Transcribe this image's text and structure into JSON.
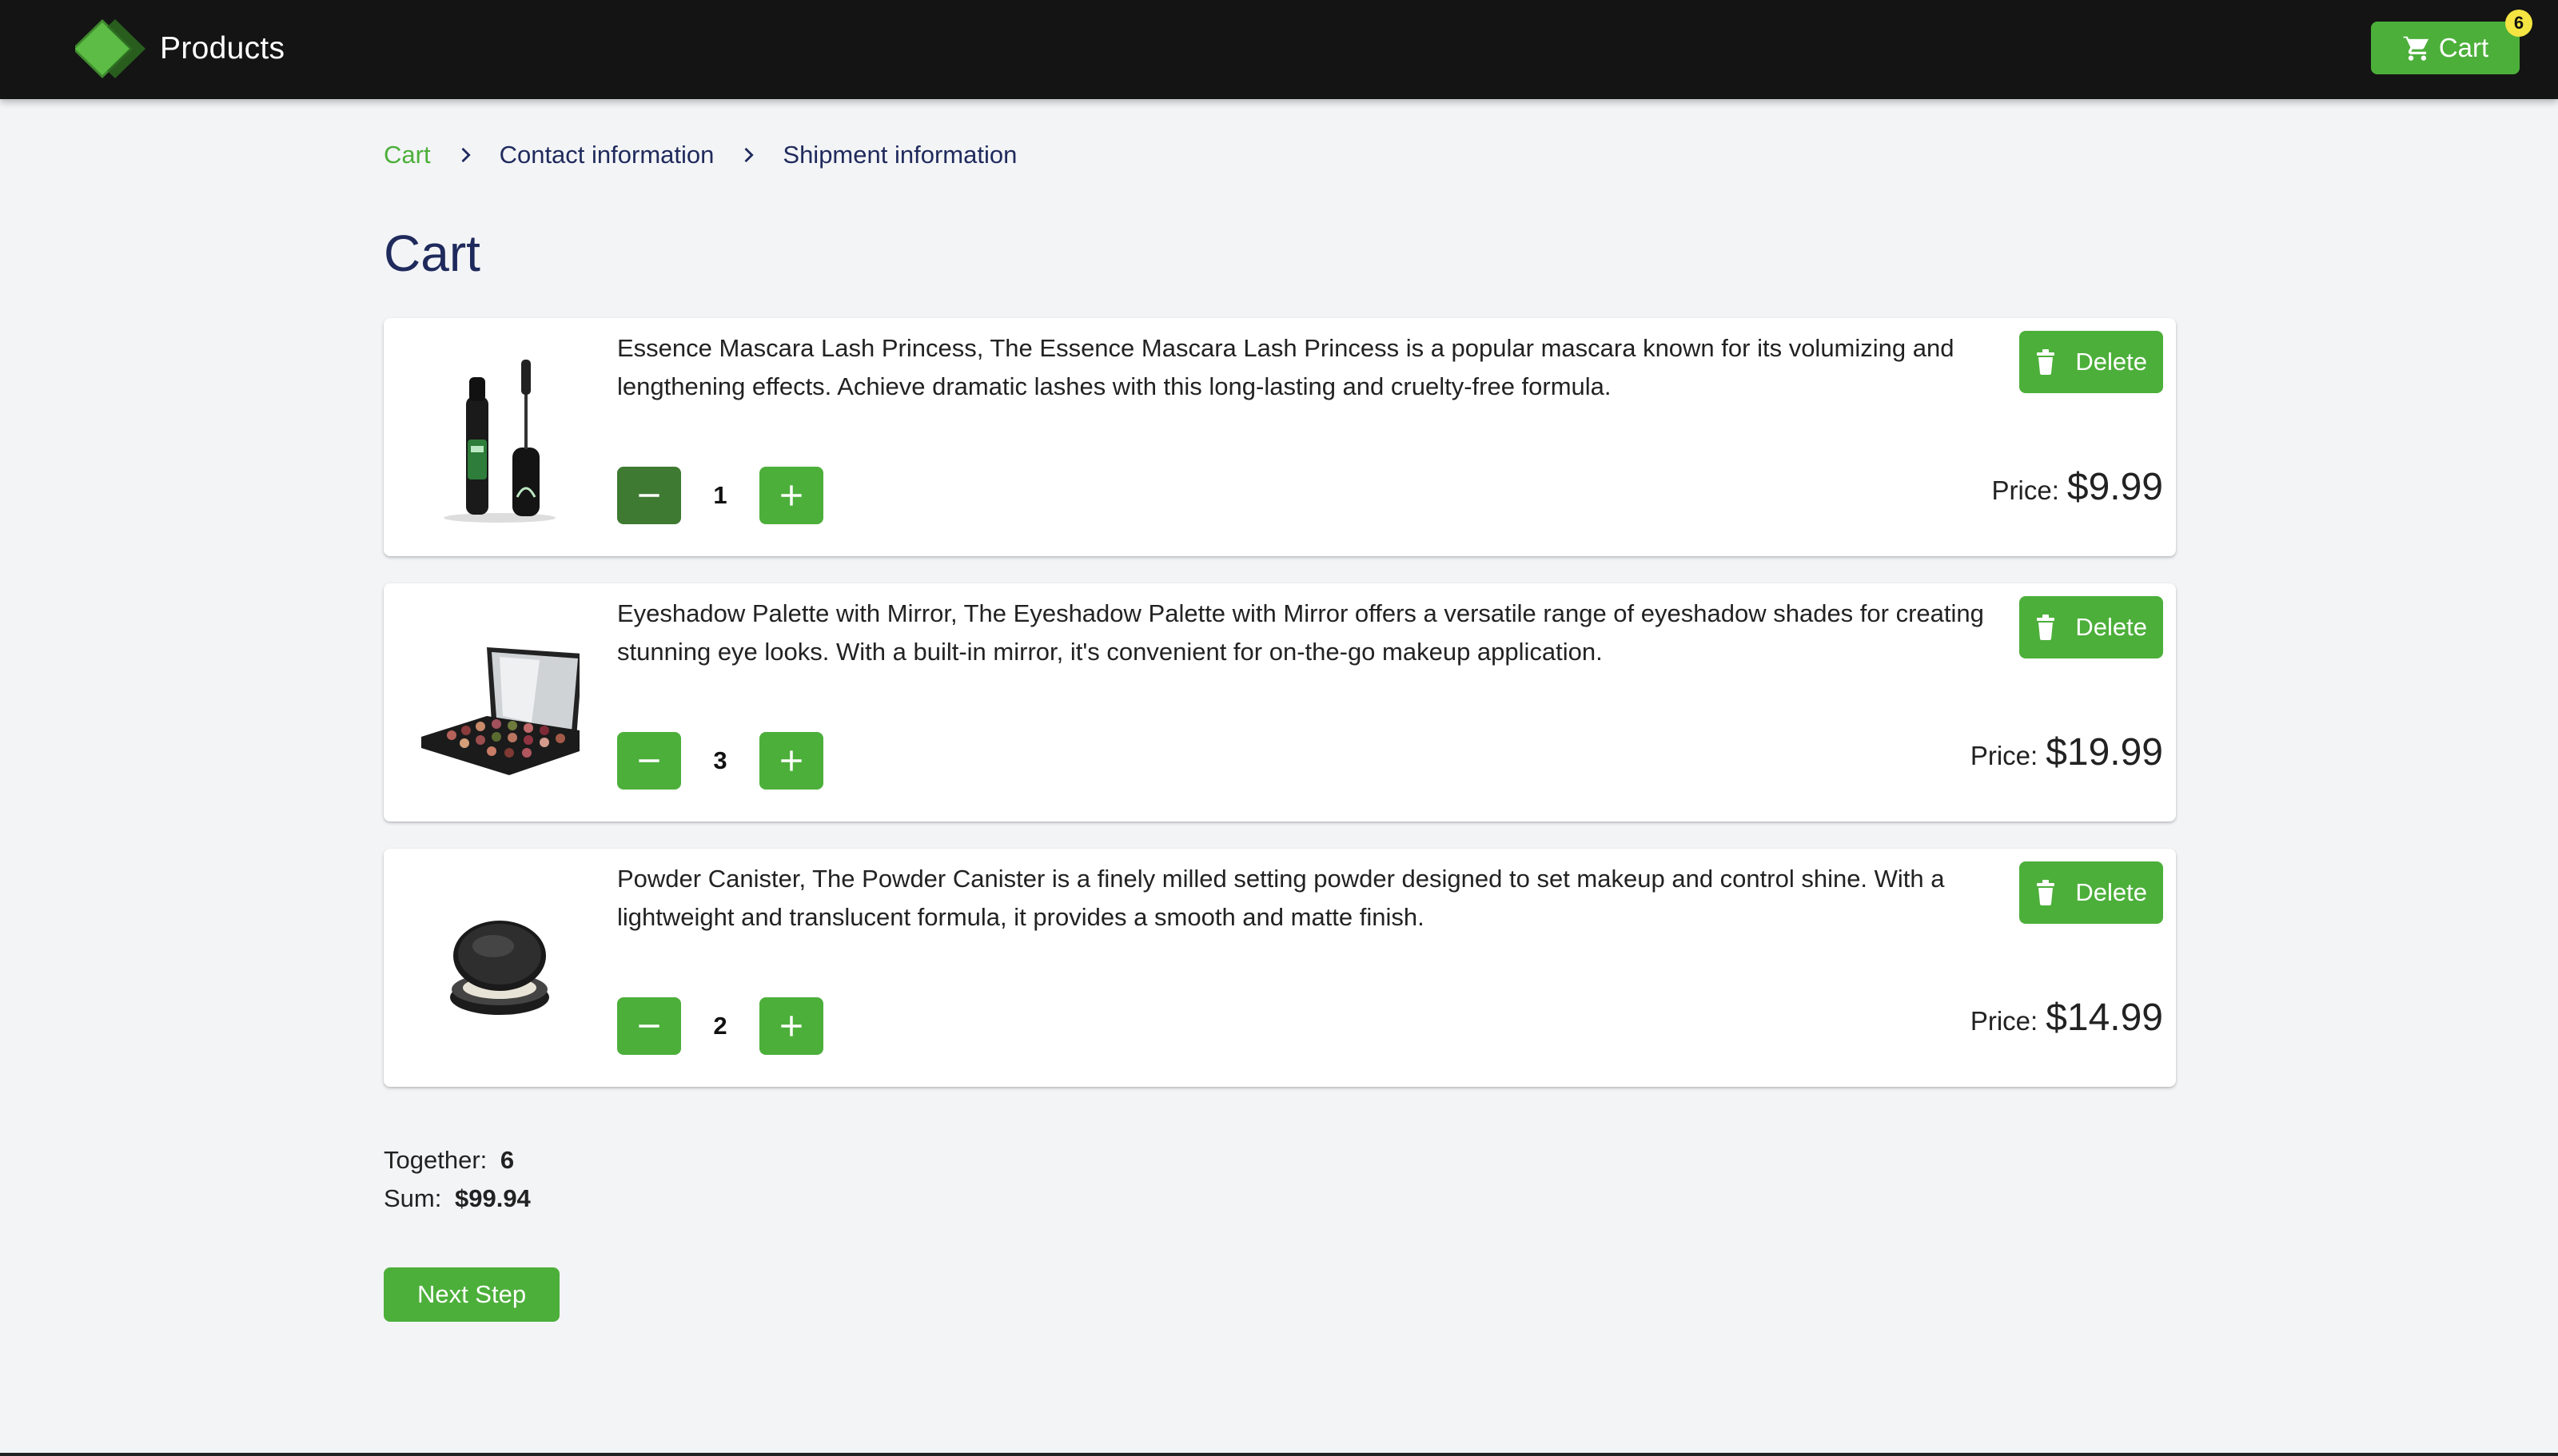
{
  "header": {
    "brand_label": "Products",
    "cart_label": "Cart",
    "cart_count": "6",
    "colors": {
      "bar": "#141414",
      "accent": "#4caf3a",
      "badge": "#f4e542"
    }
  },
  "breadcrumb": {
    "items": [
      {
        "label": "Cart",
        "active": true
      },
      {
        "label": "Contact information",
        "active": false
      },
      {
        "label": "Shipment information",
        "active": false
      }
    ]
  },
  "page": {
    "title": "Cart"
  },
  "cart": {
    "items": [
      {
        "description": "Essence Mascara Lash Princess, The Essence Mascara Lash Princess is a popular mascara known for its volumizing and lengthening effects. Achieve dramatic lashes with this long-lasting and cruelty-free formula.",
        "quantity": "1",
        "price_label": "Price:",
        "price": "$9.99",
        "delete_label": "Delete",
        "image_icon": "mascara-image"
      },
      {
        "description": "Eyeshadow Palette with Mirror, The Eyeshadow Palette with Mirror offers a versatile range of eyeshadow shades for creating stunning eye looks. With a built-in mirror, it's convenient for on-the-go makeup application.",
        "quantity": "3",
        "price_label": "Price:",
        "price": "$19.99",
        "delete_label": "Delete",
        "image_icon": "eyeshadow-palette-image"
      },
      {
        "description": "Powder Canister, The Powder Canister is a finely milled setting powder designed to set makeup and control shine. With a lightweight and translucent formula, it provides a smooth and matte finish.",
        "quantity": "2",
        "price_label": "Price:",
        "price": "$14.99",
        "delete_label": "Delete",
        "image_icon": "powder-canister-image"
      }
    ]
  },
  "totals": {
    "together_label": "Together:",
    "together_value": "6",
    "sum_label": "Sum:",
    "sum_value": "$99.94"
  },
  "actions": {
    "next_label": "Next Step"
  }
}
